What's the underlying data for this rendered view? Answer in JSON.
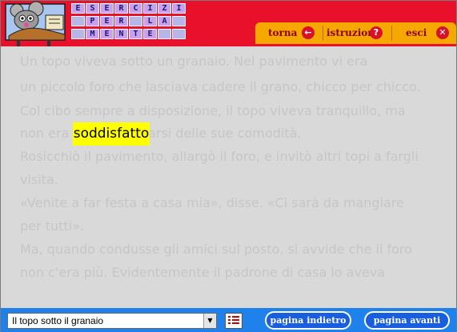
{
  "header": {
    "title_rows": [
      [
        "E",
        "S",
        "E",
        "R",
        "C",
        "I",
        "Z",
        "I"
      ],
      [
        "",
        "P",
        "E",
        "R",
        "",
        "L",
        "A",
        ""
      ],
      [
        "",
        "M",
        "E",
        "N",
        "T",
        "E",
        "",
        ""
      ]
    ],
    "buttons": {
      "back_label": "torna",
      "instructions_label": "istruzioni",
      "exit_label": "esci",
      "back_icon": "arrow-left-icon",
      "instructions_icon": "question-icon",
      "exit_icon": "close-icon"
    },
    "icon_glyphs": {
      "arrow": "←",
      "question": "?",
      "close": "✕"
    }
  },
  "text": {
    "lines": [
      "Un topo viveva sotto un granaio. Nel pavimento vi era",
      "un piccolo foro che lasciava cadere il grano, chicco per chicco.",
      "Col cibo sempre a disposizione, il topo viveva tranquillo, ma",
      "non era                        e volle vantarsi delle sue comodità.",
      "Rosicchiò il pavimento, allargò il foro, e invitò altri topi a fargli",
      "visita.",
      "«Venite a far festa a casa mia», disse. «Ci sarà da mangiare",
      "per tutti».",
      "Ma, quando condusse gli amici sul posto, si avvide che il foro",
      "non c'era più. Evidentemente il padrone di casa lo aveva"
    ],
    "highlighted_word": "soddisfatto"
  },
  "bottom": {
    "story_select_value": "Il topo sotto il granaio",
    "prev_label": "pagina indietro",
    "next_label": "pagina avanti",
    "dropdown_arrow": "▼"
  },
  "colors": {
    "header_red": "#e8102a",
    "toolbar_orange": "#f5a800",
    "bottom_blue": "#1f82ec",
    "highlight_yellow": "#ffff00"
  }
}
